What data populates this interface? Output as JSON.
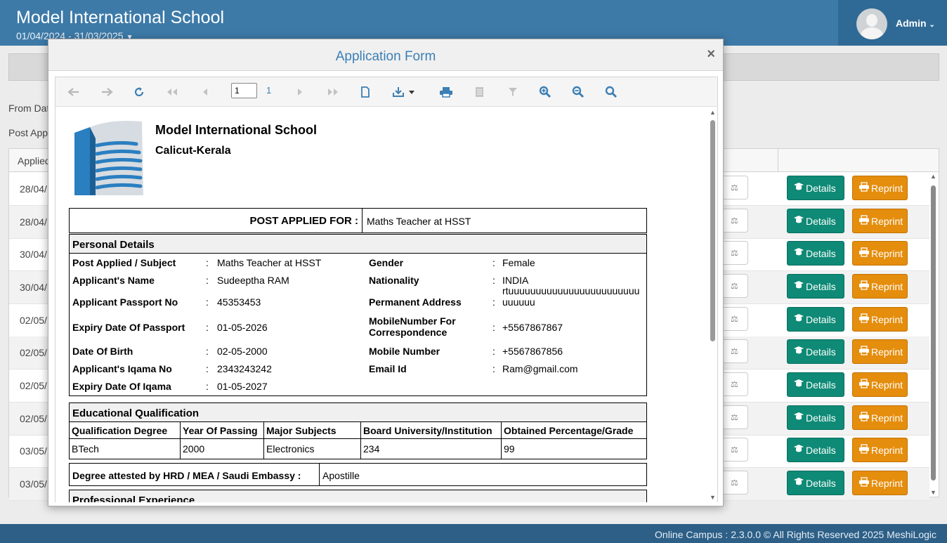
{
  "header": {
    "app_title": "Model International School",
    "academic_year": "01/04/2024 - 31/03/2025",
    "user": "Admin"
  },
  "background": {
    "from_date_label": "From Dat",
    "post_label": "Post App",
    "column_applied": "Applied",
    "rows": [
      {
        "date": "28/04/"
      },
      {
        "date": "28/04/"
      },
      {
        "date": "30/04/"
      },
      {
        "date": "30/04/"
      },
      {
        "date": "02/05/"
      },
      {
        "date": "02/05/"
      },
      {
        "date": "02/05/"
      },
      {
        "date": "02/05/"
      },
      {
        "date": "03/05/"
      },
      {
        "date": "03/05/"
      }
    ],
    "details_label": "Details",
    "reprint_label": "Reprint"
  },
  "footer": {
    "text": "Online Campus : 2.3.0.0 © All Rights Reserved 2025 MeshiLogic"
  },
  "modal": {
    "title": "Application Form",
    "close": "×",
    "toolbar": {
      "page_current": "1",
      "page_total": "1",
      "icons": [
        "back-icon",
        "forward-icon",
        "refresh-icon",
        "first-page-icon",
        "prev-page-icon",
        "next-page-icon",
        "last-page-icon",
        "document-icon",
        "export-icon",
        "print-icon",
        "copy-icon",
        "filter-icon",
        "zoom-in-icon",
        "zoom-out-icon",
        "search-icon"
      ]
    },
    "report": {
      "school_name": "Model International School",
      "school_place": "Calicut-Kerala",
      "post_applied_label": "POST APPLIED FOR :",
      "post_applied_value": "Maths Teacher at HSST",
      "personal_title": "Personal Details",
      "personal_left": [
        {
          "label": "Post Applied / Subject",
          "value": "Maths Teacher at HSST"
        },
        {
          "label": "Applicant's Name",
          "value": "Sudeeptha RAM"
        },
        {
          "label": "Applicant Passport No",
          "value": "45353453"
        },
        {
          "label": "Expiry Date Of Passport",
          "value": "01-05-2026"
        },
        {
          "label": "Date Of Birth",
          "value": "02-05-2000"
        },
        {
          "label": "Applicant's Iqama No",
          "value": "2343243242"
        },
        {
          "label": "Expiry Date Of Iqama",
          "value": "01-05-2027"
        }
      ],
      "personal_right": [
        {
          "label": "Gender",
          "value": "Female"
        },
        {
          "label": "Nationality",
          "value": "INDIA"
        },
        {
          "label": "Permanent Address",
          "value": "rtuuuuuuuuuuuuuuuuuuuuuuuuuuuuuu"
        },
        {
          "label": "MobileNumber For Correspondence",
          "value": "+5567867867"
        },
        {
          "label": "Mobile Number",
          "value": "+5567867856"
        },
        {
          "label": "Email Id",
          "value": "Ram@gmail.com"
        }
      ],
      "edu_title": "Educational Qualification",
      "edu_columns": [
        "Qualification Degree",
        "Year Of Passing",
        "Major Subjects",
        "Board University/Institution",
        "Obtained Percentage/Grade"
      ],
      "edu_rows": [
        [
          "BTech",
          "2000",
          "Electronics",
          "234",
          "99"
        ]
      ],
      "attest_label": "Degree attested by HRD / MEA / Saudi Embassy :",
      "attest_value": "Apostille",
      "prof_title": "Professional Experience"
    }
  }
}
